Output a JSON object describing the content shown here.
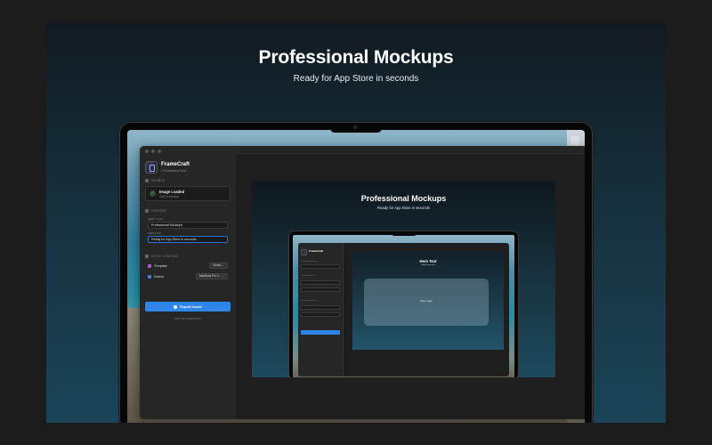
{
  "hero": {
    "title": "Professional Mockups",
    "subtitle": "Ready for App Store in seconds"
  },
  "app": {
    "name": "FrameCraft",
    "tagline": "A Professional Suite"
  },
  "sidebar": {
    "source_label": "SOURCE",
    "source_title": "Image Loaded",
    "source_sub": "Click to replace",
    "content_label": "CONTENT",
    "hero_text_label": "HERO TEXT",
    "hero_text_value": "Professional Mockups",
    "subtitle_label": "SUBTITLE",
    "subtitle_value": "Ready for App Store in seconds",
    "style_label": "STYLE & DEVICE",
    "template_label": "Template",
    "template_value": "Ocean",
    "device_label": "Device",
    "device_value": "MacBook Pro 1...",
    "export_label": "Export Asset",
    "api_label": "MCP AUTOMATION"
  },
  "preview": {
    "title": "Professional Mockups",
    "subtitle": "Ready for App Store in seconds",
    "nested": {
      "app_name": "FrameCraft",
      "canvas_title": "Hero Text",
      "canvas_sub": "Subtitle goes here",
      "drop_text": "Drop image"
    }
  },
  "colors": {
    "accent": "#2f86ea",
    "success": "#5ed16a",
    "template_icon": "#b04fd8",
    "device_icon": "#4a7fe0"
  },
  "icons": {
    "check": "check-icon",
    "export": "export-icon"
  }
}
